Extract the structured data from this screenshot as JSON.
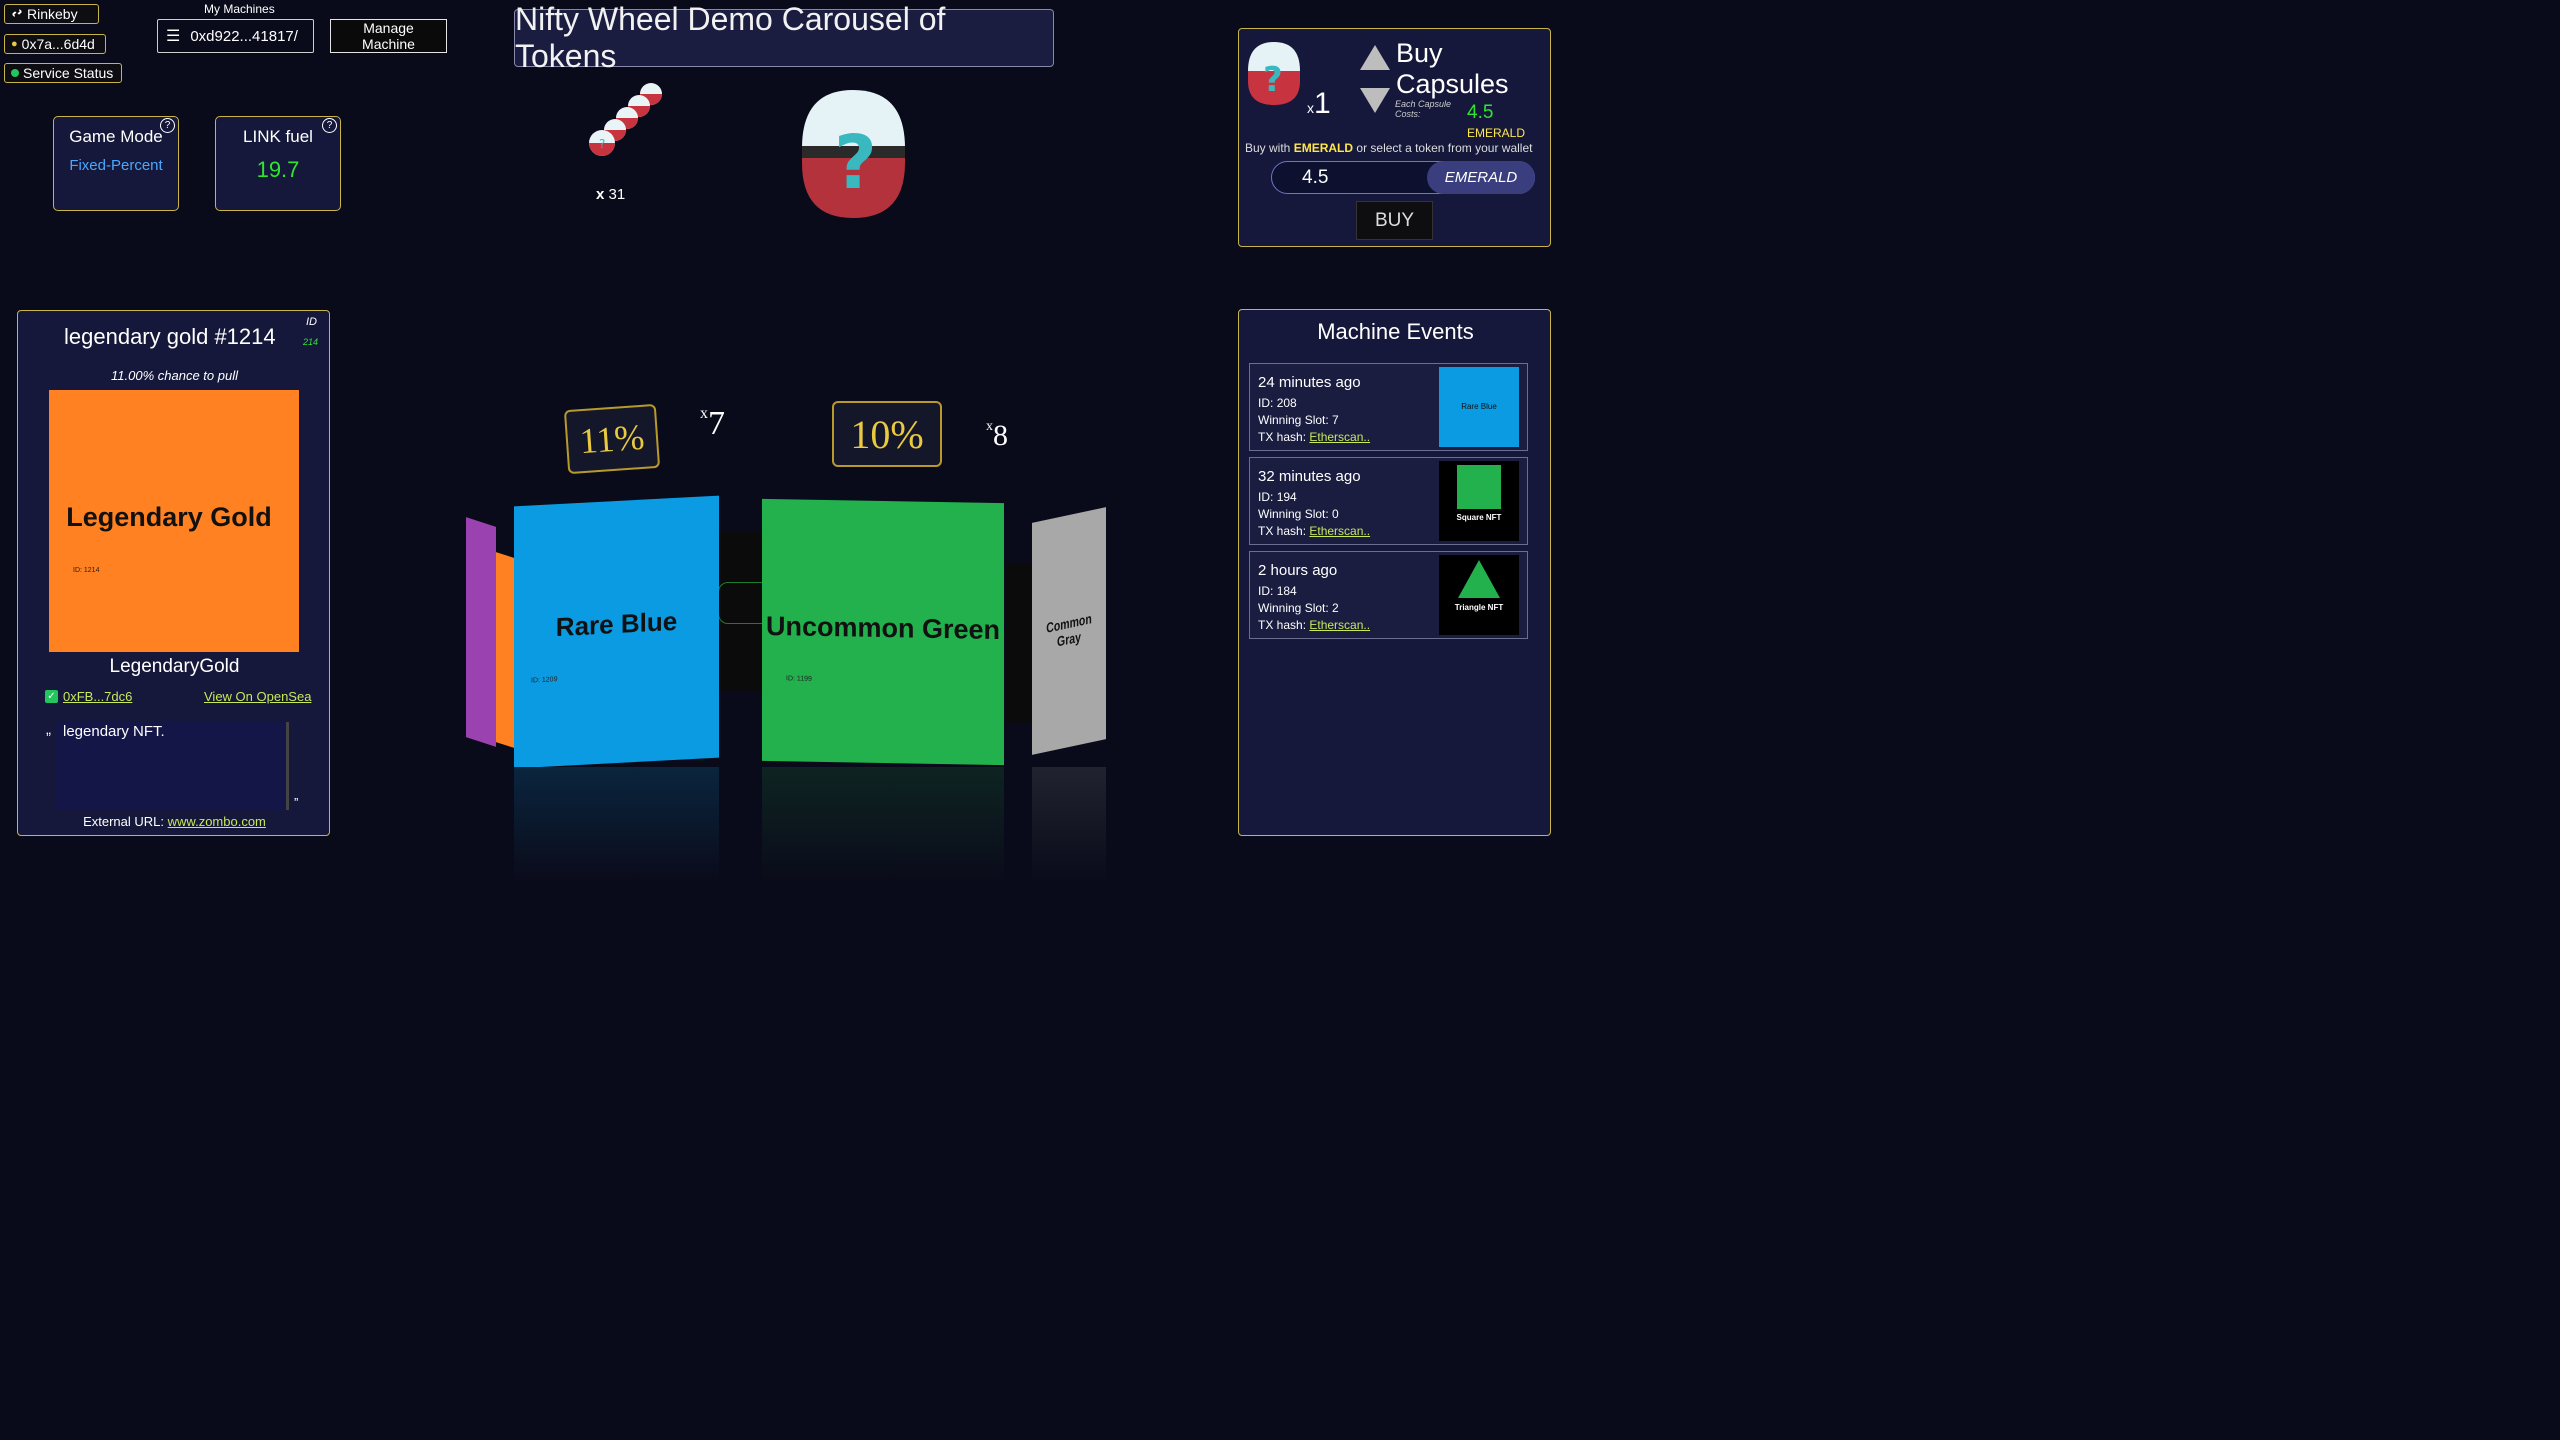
{
  "network": {
    "label": "Rinkeby"
  },
  "wallet": {
    "address": "0x7a...6d4d"
  },
  "service": {
    "label": "Service Status"
  },
  "machines": {
    "label": "My Machines",
    "selected": "0xd922...41817/",
    "manage_label": "Manage Machine"
  },
  "title": "Nifty Wheel Demo Carousel of Tokens",
  "game_mode": {
    "label": "Game Mode",
    "value": "Fixed-Percent",
    "help": "?"
  },
  "link_fuel": {
    "label": "LINK fuel",
    "value": "19.7",
    "help": "?"
  },
  "capsule_stack": {
    "count_prefix": "x",
    "count": "31"
  },
  "buy": {
    "title": "Buy Capsules",
    "qty_prefix": "x",
    "qty": "1",
    "each_label": "Each Capsule Costs:",
    "price": "4.5",
    "currency": "EMERALD",
    "buy_with_prefix": "Buy with",
    "buy_with_token": "EMERALD",
    "buy_with_suffix": "or select a token from your wallet",
    "amount_value": "4.5",
    "currency_button": "EMERALD",
    "buy_button": "BUY"
  },
  "token": {
    "title": "legendary gold #1214",
    "id_label": "ID",
    "id_value": "214",
    "chance": "11.00% chance to pull",
    "image_text": "Legendary Gold",
    "image_id": "ID: 1214",
    "name": "LegendaryGold",
    "owner": "0xFB...7dc6",
    "opensea": "View On OpenSea",
    "quote_open": "„",
    "description": "legendary NFT.",
    "quote_close": "”",
    "external_label": "External URL:",
    "external_url": "www.zombo.com",
    "image_color": "#ff8121"
  },
  "events": {
    "title": "Machine Events",
    "id_prefix": "ID:",
    "slot_prefix": "Winning Slot:",
    "tx_prefix": "TX hash:",
    "items": [
      {
        "time": "24 minutes ago",
        "id": "208",
        "slot": "7",
        "tx": "Etherscan..",
        "thumb_label": "Rare Blue",
        "thumb_color": "#0a9be3"
      },
      {
        "time": "32 minutes ago",
        "id": "194",
        "slot": "0",
        "tx": "Etherscan..",
        "thumb_label": "Square NFT",
        "thumb_color": "#22b14c"
      },
      {
        "time": "2 hours ago",
        "id": "184",
        "slot": "2",
        "tx": "Etherscan..",
        "thumb_label": "Triangle NFT",
        "thumb_color": "#22b14c"
      }
    ]
  },
  "carousel": {
    "tag_left": "11%",
    "mult_left_prefix": "x",
    "mult_left": "7",
    "tag_right": "10%",
    "mult_right_prefix": "x",
    "mult_right": "8",
    "card_blue": {
      "label": "Rare Blue",
      "id": "ID: 1209",
      "color": "#0a9be3"
    },
    "card_green": {
      "label": "Uncommon Green",
      "id": "ID: 1199",
      "color": "#22b14c"
    },
    "card_gray": {
      "label": "Common Gray",
      "color": "#a8a8a8"
    },
    "card_purple_color": "#9a42b0"
  }
}
